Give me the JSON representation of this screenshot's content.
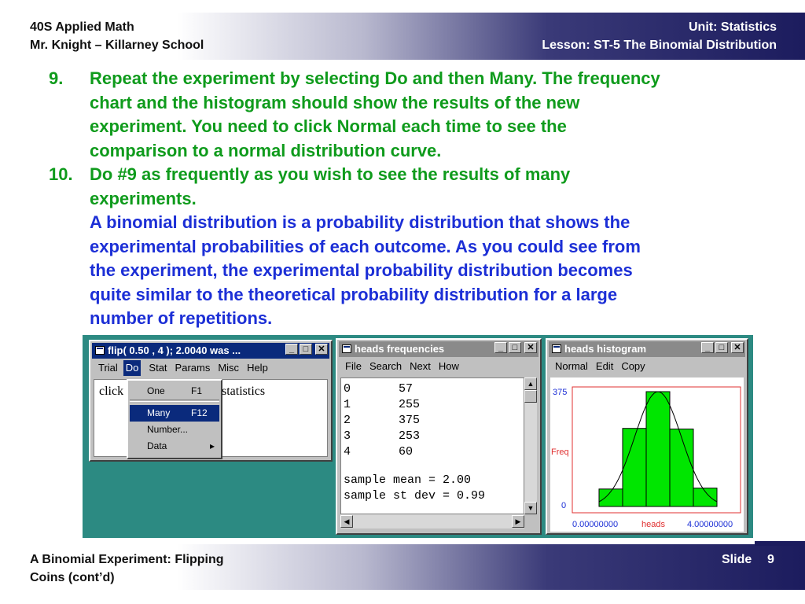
{
  "header": {
    "course": "40S Applied Math",
    "teacher": "Mr. Knight – Killarney School",
    "unit": "Unit: Statistics",
    "lesson": "Lesson: ST-5 The Binomial Distribution"
  },
  "items": [
    {
      "number": "9.",
      "lines": [
        "Repeat the experiment by selecting Do and then Many. The frequency",
        "chart and the histogram should show the results of the new",
        "experiment. You need to click Normal each time to see the",
        "comparison to a normal distribution curve."
      ]
    },
    {
      "number": "10.",
      "lines": [
        "Do #9 as frequently as you wish to see the results of many",
        "experiments."
      ]
    }
  ],
  "paragraph": [
    "A binomial distribution is a probability distribution that shows the",
    "experimental probabilities of each outcome. As you could see from",
    "the experiment, the experimental probability distribution becomes",
    "quite similar to the theoretical probability distribution for a large",
    "number of repetitions."
  ],
  "screenshot": {
    "flip_window": {
      "title": "flip( 0.50 , 4 );   2.0040 was ...",
      "menu": [
        "Trial",
        "Do",
        "Stat",
        "Params",
        "Misc",
        "Help"
      ],
      "client_left": "click",
      "client_right": "statistics",
      "dropdown": [
        {
          "label": "One",
          "shortcut": "F1"
        },
        {
          "label": "Many",
          "shortcut": "F12"
        },
        {
          "label": "Number...",
          "shortcut": ""
        },
        {
          "label": "Data",
          "shortcut": "▸"
        }
      ]
    },
    "freq_window": {
      "title": "heads frequencies",
      "menu": [
        "File",
        "Search",
        "Next",
        "How"
      ],
      "rows": [
        {
          "outcome": "0",
          "count": "57"
        },
        {
          "outcome": "1",
          "count": "255"
        },
        {
          "outcome": "2",
          "count": "375"
        },
        {
          "outcome": "3",
          "count": "253"
        },
        {
          "outcome": "4",
          "count": "60"
        }
      ],
      "mean_line": "sample mean = 2.00",
      "sd_line": "sample st dev = 0.99"
    },
    "hist_window": {
      "title": "heads histogram",
      "menu": [
        "Normal",
        "Edit",
        "Copy"
      ],
      "y_max_label": "375",
      "y_axis_label": "Freq",
      "y_min_label": "0",
      "x_min_label": "0.00000000",
      "x_axis_label": "heads",
      "x_max_label": "4.00000000",
      "bar_color": "#00e600"
    }
  },
  "chart_data": {
    "type": "bar",
    "categories": [
      "0",
      "1",
      "2",
      "3",
      "4"
    ],
    "values": [
      57,
      255,
      375,
      253,
      60
    ],
    "title": "heads histogram",
    "xlabel": "heads",
    "ylabel": "Freq",
    "ylim": [
      0,
      375
    ],
    "xlim": [
      0.0,
      4.0
    ],
    "overlay": "normal curve",
    "grid": false
  },
  "footer": {
    "title_line1": "A Binomial Experiment: Flipping",
    "title_line2": "Coins (cont’d)",
    "slide_label": "Slide",
    "slide_number": "9"
  }
}
